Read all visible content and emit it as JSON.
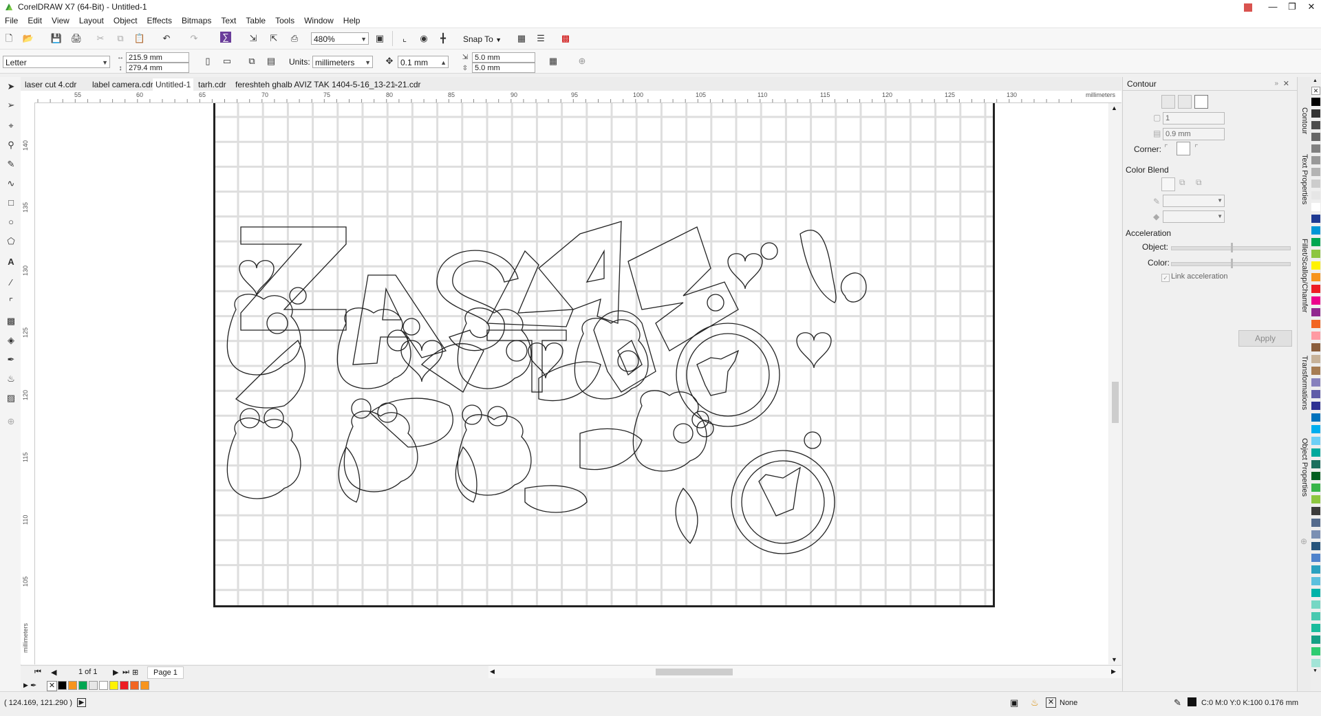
{
  "window": {
    "title": "CorelDRAW X7 (64-Bit) - Untitled-1"
  },
  "menu": [
    "File",
    "Edit",
    "View",
    "Layout",
    "Object",
    "Effects",
    "Bitmaps",
    "Text",
    "Table",
    "Tools",
    "Window",
    "Help"
  ],
  "toolbar": {
    "zoom": "480%",
    "snap_to": "Snap To"
  },
  "property_bar": {
    "page_size": "Letter",
    "width": "215.9 mm",
    "height": "279.4 mm",
    "units_label": "Units:",
    "units_value": "millimeters",
    "nudge": "0.1 mm",
    "dup_x": "5.0 mm",
    "dup_y": "5.0 mm"
  },
  "doc_tabs": [
    "laser cut 4.cdr",
    "label camera.cdr",
    "Untitled-1",
    "tarh.cdr",
    "fereshteh ghalb AVIZ TAK 1404-5-16_13-21-21.cdr"
  ],
  "active_tab": "Untitled-1",
  "ruler": {
    "h_labels": [
      "55",
      "60",
      "65",
      "70",
      "75",
      "80",
      "85",
      "90",
      "95",
      "100",
      "105",
      "110",
      "115",
      "120",
      "125",
      "130"
    ],
    "unit": "millimeters",
    "v_labels": [
      "140",
      "135",
      "130",
      "125",
      "120",
      "115",
      "110",
      "105"
    ],
    "v_unit": "millimeters"
  },
  "page_nav": {
    "counter": "1 of 1",
    "page_tab": "Page 1"
  },
  "docker": {
    "title": "Contour",
    "steps": "1",
    "offset": "0.9 mm",
    "corner_label": "Corner:",
    "color_blend_label": "Color Blend",
    "acceleration_label": "Acceleration",
    "object_label": "Object:",
    "color_label": "Color:",
    "link_label": "Link acceleration",
    "apply_label": "Apply"
  },
  "docker_tabs": [
    "Contour",
    "Text Properties",
    "Fillet/Scallop/Chamfer",
    "Transformations",
    "Object Properties"
  ],
  "status": {
    "coords": "( 124.169, 121.290 )",
    "fill_label": "None",
    "outline": "C:0 M:0 Y:0 K:100  0.176 mm"
  },
  "palette_colors": [
    "#000000",
    "#333333",
    "#4d4d4d",
    "#666666",
    "#808080",
    "#999999",
    "#b3b3b3",
    "#cccccc",
    "#e6e6e6",
    "#ffffff",
    "#1f3a93",
    "#0096d6",
    "#00a651",
    "#8dc63f",
    "#fff200",
    "#f7941d",
    "#ed1c24",
    "#ec008c",
    "#92278f",
    "#f26522",
    "#ff9aa2",
    "#8b5e3c",
    "#c7b299",
    "#a67c52",
    "#8781bd",
    "#605ca8",
    "#2e3192",
    "#0072bc",
    "#00aeef",
    "#6dcff6",
    "#00a99d",
    "#1a6f5e",
    "#005e20",
    "#39b54a",
    "#8cc63f",
    "#3b3b3b",
    "#556b8d",
    "#7a8fb3",
    "#26547c",
    "#4f83cc",
    "#2aa1c0",
    "#5bc0de",
    "#00b2a9",
    "#76d7c4",
    "#48c9b0",
    "#1abc9c",
    "#16a085",
    "#2ecc71",
    "#a3e4d7"
  ],
  "doc_palette": [
    "#000000",
    "#f7941d",
    "#00a651",
    "#e6e6e6",
    "#ffffff",
    "#fff200",
    "#ed1c24",
    "#f26522",
    "#f7941d"
  ]
}
